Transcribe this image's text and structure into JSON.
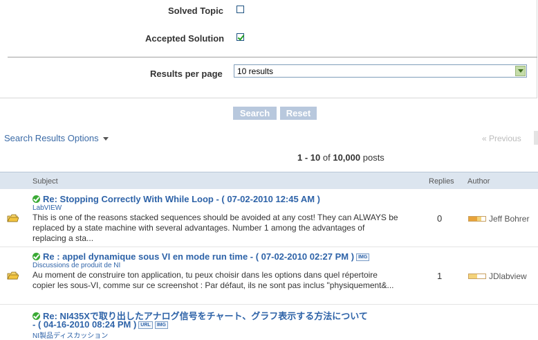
{
  "form": {
    "solved_topic_label": "Solved Topic",
    "accepted_solution_label": "Accepted Solution",
    "results_per_page_label": "Results per page",
    "results_per_page_value": "10 results",
    "search_button": "Search",
    "reset_button": "Reset"
  },
  "options_label": "Search Results Options",
  "pagination": {
    "previous": "« Previous"
  },
  "count": {
    "range": "1 - 10",
    "of": "of",
    "total": "10,000",
    "unit": "posts"
  },
  "columns": {
    "subject": "Subject",
    "replies": "Replies",
    "author": "Author"
  },
  "results": [
    {
      "title": "Re: Stopping Correctly With While Loop - ( 07-02-2010 12:45 AM )",
      "board": "LabVIEW",
      "snippet": "This is one of the reasons stacked sequences should be avoided at any cost!   They can ALWAYS be replaced by a state machine with several advantages.  Number 1 among the advantages of replacing a sta...",
      "replies": "0",
      "author": "Jeff Bohrer",
      "rank_colors": [
        "#e8a33a",
        "#e8a33a",
        "#f4d37a",
        "#ffffff"
      ]
    },
    {
      "title": "Re : appel dynamique sous VI en mode run time - ( 07-02-2010 02:27 PM )",
      "tags": [
        "IMG"
      ],
      "board": "Discussions de produit de NI",
      "snippet": "Au moment de construire ton application, tu peux choisir dans les options dans quel répertoire copier les sous-VI, comme sur ce screenshot :    Par défaut, ils ne sont pas inclus \"physiquement&...",
      "replies": "1",
      "author": "JDlabview",
      "rank_colors": [
        "#f4d37a",
        "#f4d37a",
        "#ffffff",
        "#ffffff"
      ]
    },
    {
      "title_line1": "Re: NI435Xで取り出したアナログ信号をチャート、グラフ表示する方法について",
      "title_line2": "- ( 04-16-2010 08:24 PM )",
      "tags": [
        "URL",
        "IMG"
      ],
      "board": "NI製品ディスカッション"
    }
  ]
}
